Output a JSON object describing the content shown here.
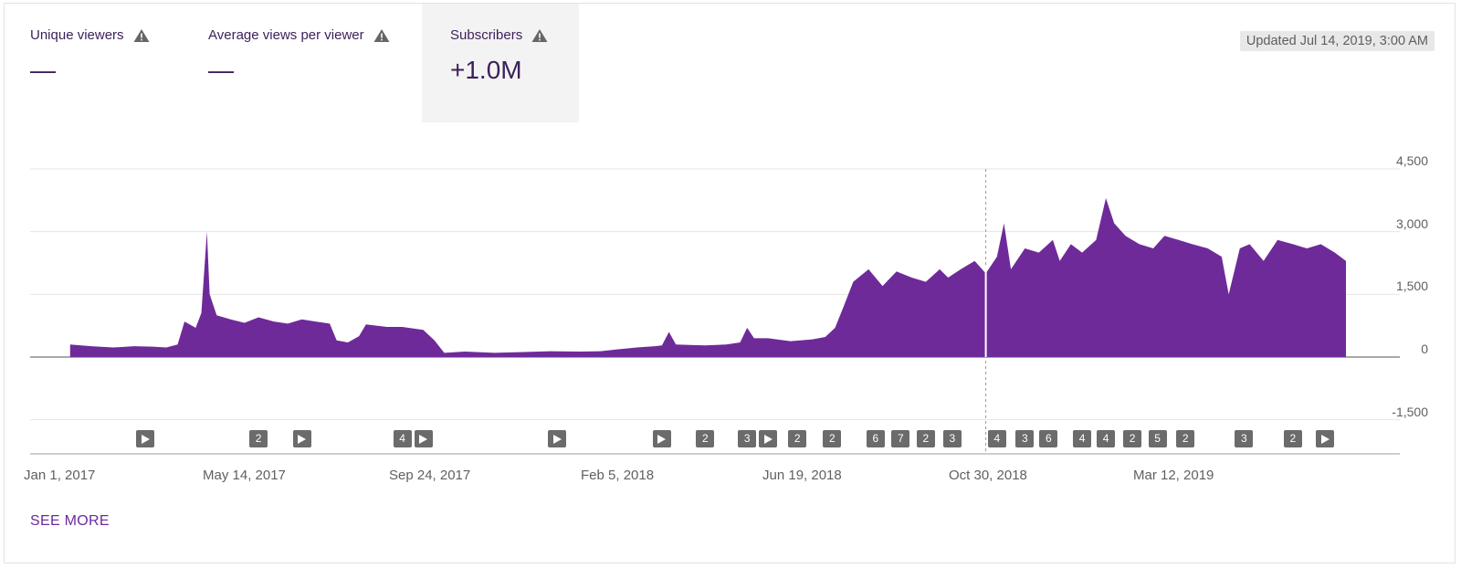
{
  "metrics": [
    {
      "label": "Unique viewers",
      "value": "—",
      "selected": false
    },
    {
      "label": "Average views per viewer",
      "value": "—",
      "selected": false
    },
    {
      "label": "Subscribers",
      "value": "+1.0M",
      "selected": true
    }
  ],
  "updated": "Updated Jul 14, 2019, 3:00 AM",
  "see_more": "SEE MORE",
  "colors": {
    "series": "#6f2a9a",
    "grid": "#e5e5e5",
    "axis": "#9e9e9e",
    "marker": "#6b6b6b"
  },
  "icons": {
    "warning": "warning-icon",
    "play": "play-icon"
  },
  "chart_data": {
    "type": "area",
    "series": [
      {
        "x_start": "2017-01-01",
        "x_end": "2019-07-13",
        "points": [
          [
            "2017-01-10",
            300
          ],
          [
            "2017-01-25",
            260
          ],
          [
            "2017-02-10",
            230
          ],
          [
            "2017-02-25",
            260
          ],
          [
            "2017-03-10",
            250
          ],
          [
            "2017-03-20",
            230
          ],
          [
            "2017-03-28",
            300
          ],
          [
            "2017-04-02",
            850
          ],
          [
            "2017-04-10",
            700
          ],
          [
            "2017-04-14",
            1050
          ],
          [
            "2017-04-18",
            3000
          ],
          [
            "2017-04-20",
            1500
          ],
          [
            "2017-04-25",
            1000
          ],
          [
            "2017-05-05",
            900
          ],
          [
            "2017-05-15",
            820
          ],
          [
            "2017-05-25",
            950
          ],
          [
            "2017-06-05",
            850
          ],
          [
            "2017-06-15",
            800
          ],
          [
            "2017-06-25",
            900
          ],
          [
            "2017-07-05",
            850
          ],
          [
            "2017-07-15",
            800
          ],
          [
            "2017-07-20",
            400
          ],
          [
            "2017-07-28",
            350
          ],
          [
            "2017-08-05",
            500
          ],
          [
            "2017-08-10",
            780
          ],
          [
            "2017-08-25",
            720
          ],
          [
            "2017-09-05",
            720
          ],
          [
            "2017-09-20",
            650
          ],
          [
            "2017-09-28",
            400
          ],
          [
            "2017-10-05",
            100
          ],
          [
            "2017-10-20",
            130
          ],
          [
            "2017-11-10",
            100
          ],
          [
            "2017-12-01",
            120
          ],
          [
            "2017-12-20",
            140
          ],
          [
            "2018-01-10",
            130
          ],
          [
            "2018-01-25",
            140
          ],
          [
            "2018-02-05",
            180
          ],
          [
            "2018-02-20",
            230
          ],
          [
            "2018-03-05",
            260
          ],
          [
            "2018-03-10",
            280
          ],
          [
            "2018-03-15",
            600
          ],
          [
            "2018-03-20",
            300
          ],
          [
            "2018-04-10",
            280
          ],
          [
            "2018-04-25",
            300
          ],
          [
            "2018-05-05",
            350
          ],
          [
            "2018-05-10",
            700
          ],
          [
            "2018-05-15",
            450
          ],
          [
            "2018-05-25",
            450
          ],
          [
            "2018-06-10",
            380
          ],
          [
            "2018-06-25",
            420
          ],
          [
            "2018-07-05",
            480
          ],
          [
            "2018-07-12",
            700
          ],
          [
            "2018-07-18",
            1200
          ],
          [
            "2018-07-25",
            1800
          ],
          [
            "2018-08-05",
            2100
          ],
          [
            "2018-08-15",
            1700
          ],
          [
            "2018-08-25",
            2050
          ],
          [
            "2018-09-05",
            1900
          ],
          [
            "2018-09-15",
            1800
          ],
          [
            "2018-09-25",
            2100
          ],
          [
            "2018-10-01",
            1900
          ],
          [
            "2018-10-10",
            2100
          ],
          [
            "2018-10-20",
            2300
          ],
          [
            "2018-10-28",
            2000
          ],
          [
            "2018-11-05",
            2400
          ],
          [
            "2018-11-10",
            3200
          ],
          [
            "2018-11-15",
            2100
          ],
          [
            "2018-11-25",
            2600
          ],
          [
            "2018-12-05",
            2500
          ],
          [
            "2018-12-15",
            2800
          ],
          [
            "2018-12-20",
            2300
          ],
          [
            "2018-12-28",
            2700
          ],
          [
            "2019-01-05",
            2500
          ],
          [
            "2019-01-15",
            2800
          ],
          [
            "2019-01-22",
            3800
          ],
          [
            "2019-01-28",
            3200
          ],
          [
            "2019-02-05",
            2900
          ],
          [
            "2019-02-15",
            2700
          ],
          [
            "2019-02-25",
            2600
          ],
          [
            "2019-03-05",
            2900
          ],
          [
            "2019-03-15",
            2800
          ],
          [
            "2019-03-25",
            2700
          ],
          [
            "2019-04-05",
            2600
          ],
          [
            "2019-04-15",
            2400
          ],
          [
            "2019-04-20",
            1500
          ],
          [
            "2019-04-28",
            2600
          ],
          [
            "2019-05-05",
            2700
          ],
          [
            "2019-05-15",
            2300
          ],
          [
            "2019-05-25",
            2800
          ],
          [
            "2019-06-05",
            2700
          ],
          [
            "2019-06-15",
            2600
          ],
          [
            "2019-06-25",
            2700
          ],
          [
            "2019-07-05",
            2500
          ],
          [
            "2019-07-13",
            2300
          ]
        ]
      }
    ],
    "y_ticks": [
      "4,500",
      "3,000",
      "1,500",
      "0",
      "-1,500"
    ],
    "ylim": [
      -1500,
      4500
    ],
    "x_ticks": [
      "Jan 1, 2017",
      "May 14, 2017",
      "Sep 24, 2017",
      "Feb 5, 2018",
      "Jun 19, 2018",
      "Oct 30, 2018",
      "Mar 12, 2019"
    ],
    "hover_line_date": "2018-10-28",
    "markers": [
      {
        "label": "play",
        "date": "2017-03-05"
      },
      {
        "label": "2",
        "date": "2017-05-25"
      },
      {
        "label": "play",
        "date": "2017-06-25"
      },
      {
        "label": "4",
        "date": "2017-09-05"
      },
      {
        "label": "play",
        "date": "2017-09-20"
      },
      {
        "label": "play",
        "date": "2017-12-25"
      },
      {
        "label": "play",
        "date": "2018-03-10"
      },
      {
        "label": "2",
        "date": "2018-04-10"
      },
      {
        "label": "3",
        "date": "2018-05-10"
      },
      {
        "label": "play",
        "date": "2018-05-25"
      },
      {
        "label": "2",
        "date": "2018-06-15"
      },
      {
        "label": "2",
        "date": "2018-07-10"
      },
      {
        "label": "6",
        "date": "2018-08-10"
      },
      {
        "label": "7",
        "date": "2018-08-28"
      },
      {
        "label": "2",
        "date": "2018-09-15"
      },
      {
        "label": "3",
        "date": "2018-10-04"
      },
      {
        "label": "4",
        "date": "2018-11-05"
      },
      {
        "label": "3",
        "date": "2018-11-25"
      },
      {
        "label": "6",
        "date": "2018-12-12"
      },
      {
        "label": "4",
        "date": "2019-01-05"
      },
      {
        "label": "4",
        "date": "2019-01-22"
      },
      {
        "label": "2",
        "date": "2019-02-10"
      },
      {
        "label": "5",
        "date": "2019-02-28"
      },
      {
        "label": "2",
        "date": "2019-03-20"
      },
      {
        "label": "3",
        "date": "2019-05-01"
      },
      {
        "label": "2",
        "date": "2019-06-05"
      },
      {
        "label": "play",
        "date": "2019-06-28"
      }
    ]
  }
}
